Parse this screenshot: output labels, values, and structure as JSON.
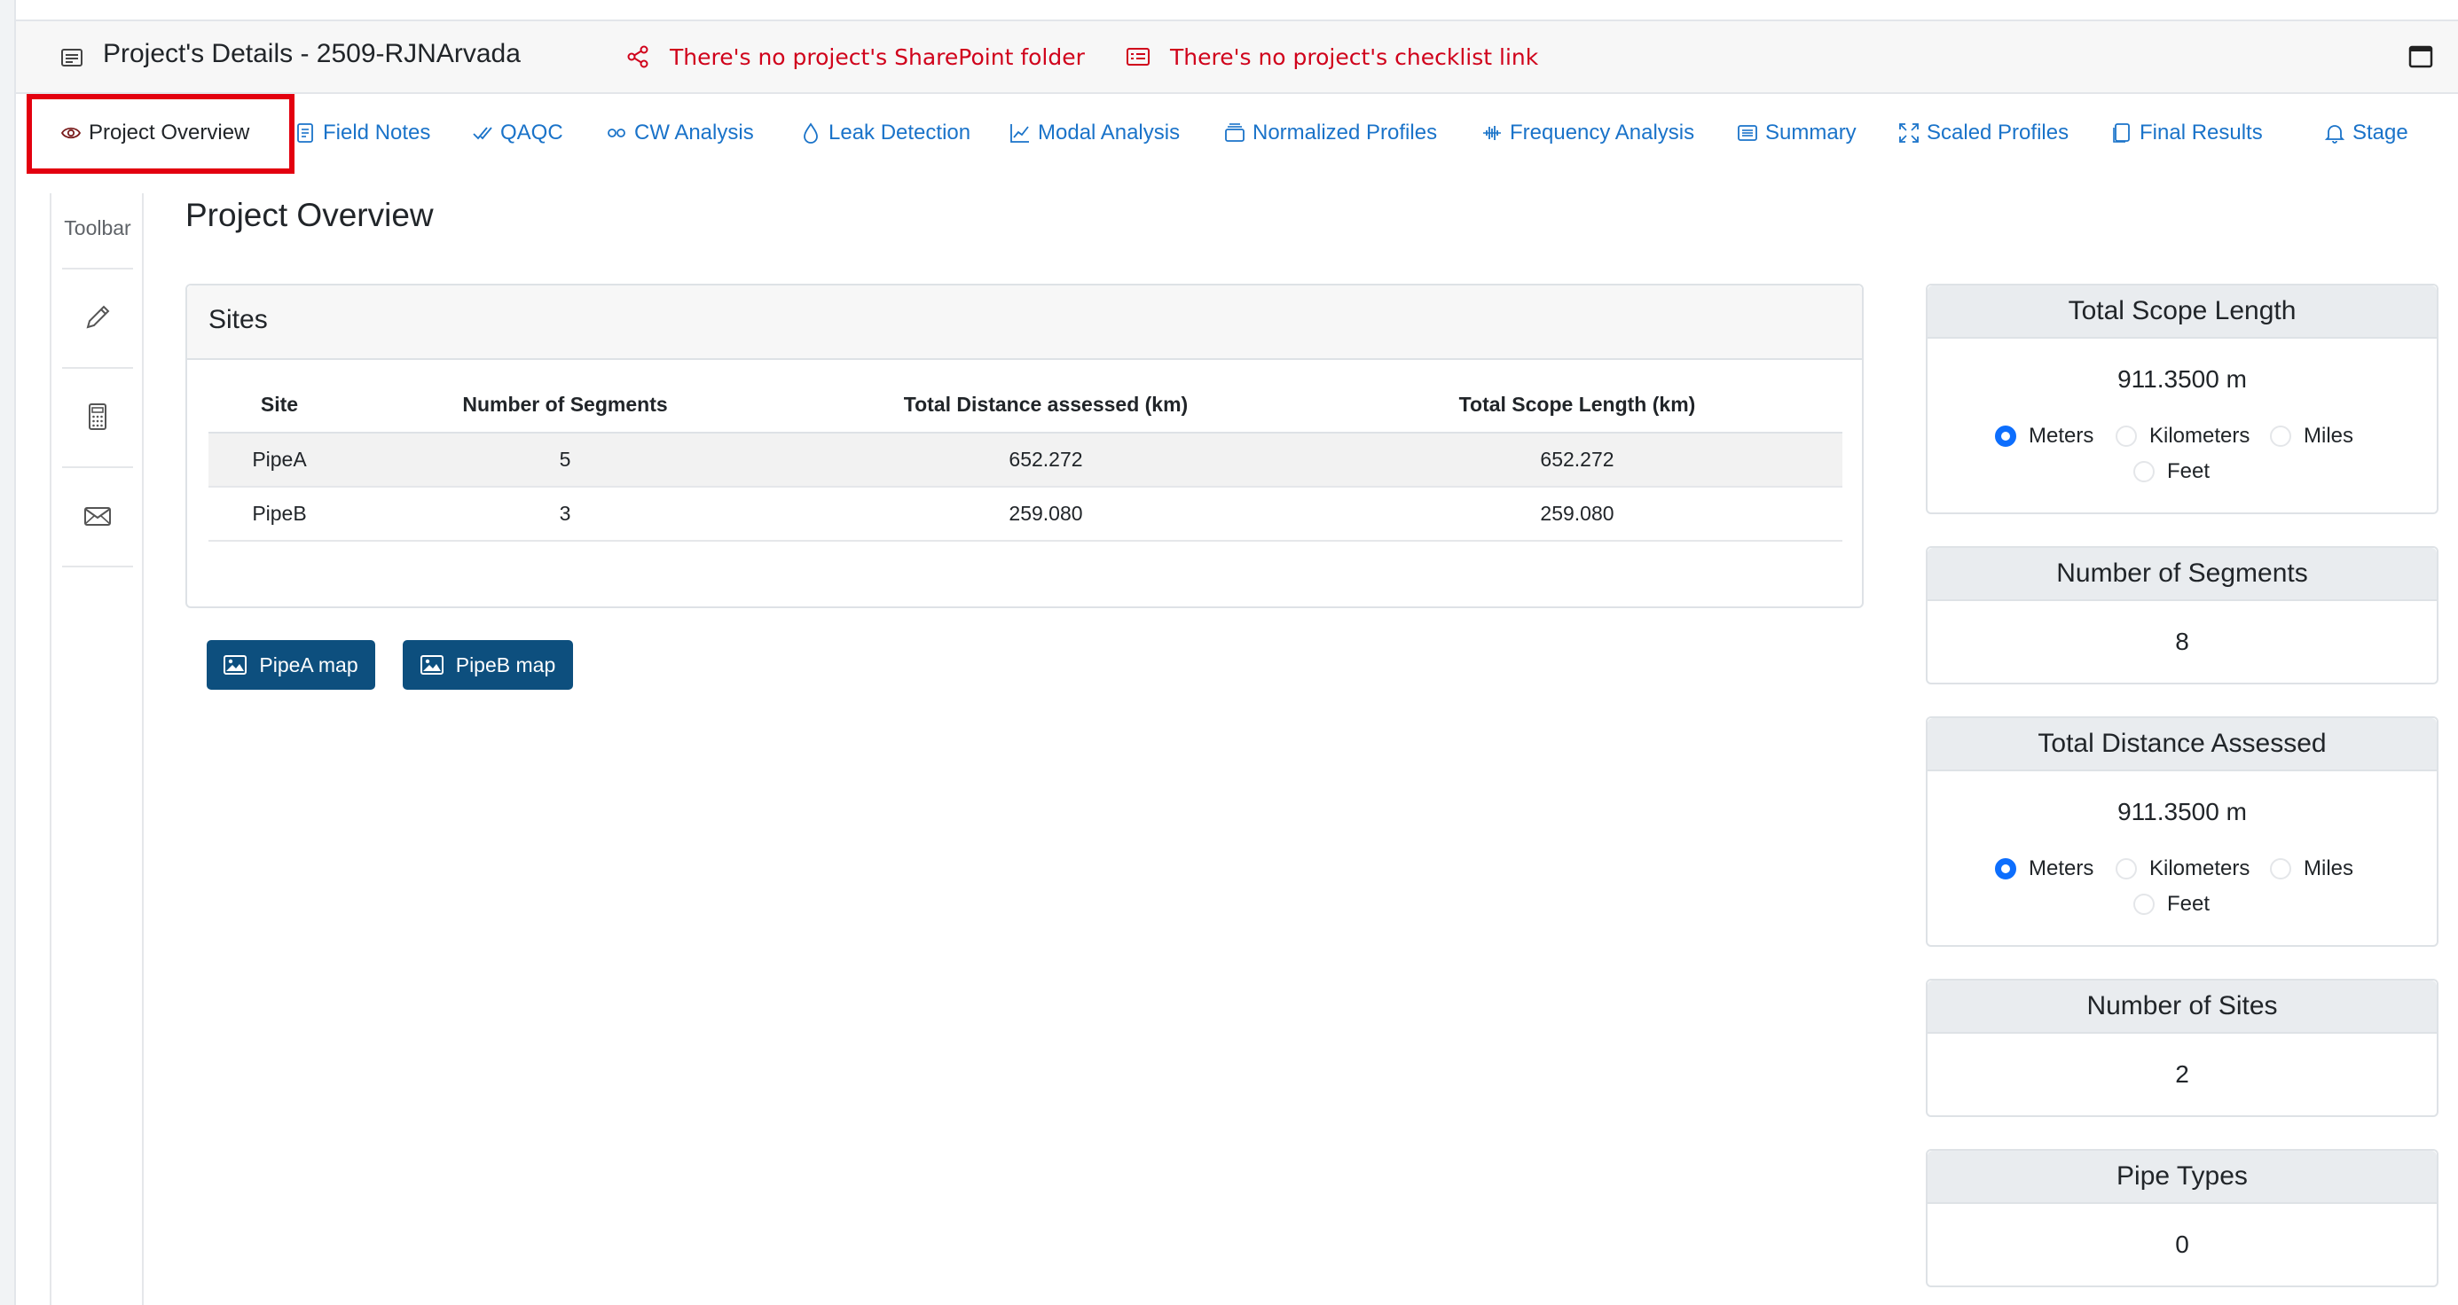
{
  "header": {
    "title": "Project's Details - 2509-RJNArvada",
    "sharepoint_warning": "There's no project's SharePoint folder",
    "checklist_warning": "There's no project's checklist link"
  },
  "tabs": [
    {
      "label": "Project Overview",
      "icon": "eye-icon",
      "active": true
    },
    {
      "label": "Field Notes",
      "icon": "notes-icon"
    },
    {
      "label": "QAQC",
      "icon": "check-icon"
    },
    {
      "label": "CW Analysis",
      "icon": "infinity-icon"
    },
    {
      "label": "Leak Detection",
      "icon": "droplet-icon"
    },
    {
      "label": "Modal Analysis",
      "icon": "line-chart-icon"
    },
    {
      "label": "Normalized Profiles",
      "icon": "layers-icon"
    },
    {
      "label": "Frequency Analysis",
      "icon": "waveform-icon"
    },
    {
      "label": "Summary",
      "icon": "list-icon"
    },
    {
      "label": "Scaled Profiles",
      "icon": "fullscreen-icon"
    },
    {
      "label": "Final Results",
      "icon": "files-icon"
    },
    {
      "label": "Stage",
      "icon": "bell-icon"
    }
  ],
  "sidebar": {
    "title": "Toolbar",
    "items": [
      "pencil-icon",
      "calculator-icon",
      "envelope-icon"
    ]
  },
  "main": {
    "title": "Project Overview",
    "sites_card": {
      "title": "Sites",
      "columns": [
        "Site",
        "Number of Segments",
        "Total Distance assessed (km)",
        "Total Scope Length (km)"
      ],
      "rows": [
        [
          "PipeA",
          "5",
          "652.272",
          "652.272"
        ],
        [
          "PipeB",
          "3",
          "259.080",
          "259.080"
        ]
      ]
    },
    "map_buttons": [
      "PipeA map",
      "PipeB map"
    ]
  },
  "stats": {
    "scope_length": {
      "title": "Total Scope Length",
      "value": "911.3500 m",
      "units": [
        "Meters",
        "Kilometers",
        "Miles",
        "Feet"
      ],
      "selected": "Meters"
    },
    "segments": {
      "title": "Number of Segments",
      "value": "8"
    },
    "distance": {
      "title": "Total Distance Assessed",
      "value": "911.3500 m",
      "units": [
        "Meters",
        "Kilometers",
        "Miles",
        "Feet"
      ],
      "selected": "Meters"
    },
    "sites": {
      "title": "Number of Sites",
      "value": "2"
    },
    "pipe_types": {
      "title": "Pipe Types",
      "value": "0"
    }
  },
  "colors": {
    "link": "#1a73c9",
    "warning": "#d0021b",
    "button": "#0d4f7e",
    "radio_checked": "#0d6efd",
    "highlight_box": "#e3000f"
  }
}
